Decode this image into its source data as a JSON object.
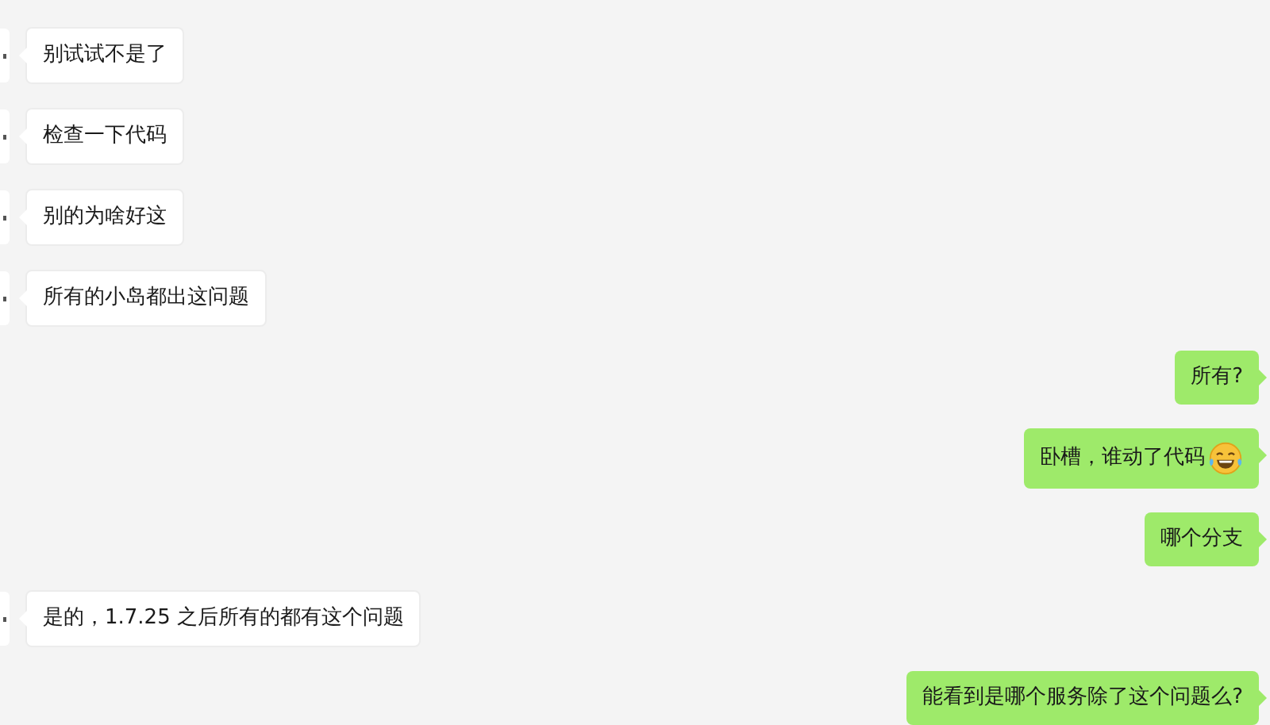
{
  "messages": [
    {
      "kind": "incoming",
      "parts": [
        {
          "kind": "text",
          "text": "别试试不是了"
        }
      ]
    },
    {
      "kind": "incoming",
      "parts": [
        {
          "kind": "text",
          "text": "检查一下代码"
        }
      ]
    },
    {
      "kind": "incoming",
      "parts": [
        {
          "kind": "text",
          "text": "别的为啥好这"
        }
      ]
    },
    {
      "kind": "incoming",
      "parts": [
        {
          "kind": "text",
          "text": "所有的小岛都出这问题"
        }
      ]
    },
    {
      "kind": "outgoing",
      "parts": [
        {
          "kind": "text",
          "text": "所有?"
        }
      ]
    },
    {
      "kind": "outgoing",
      "parts": [
        {
          "kind": "text",
          "text": "卧槽，谁动了代码"
        },
        {
          "kind": "emoji"
        }
      ]
    },
    {
      "kind": "outgoing",
      "parts": [
        {
          "kind": "text",
          "text": "哪个分支"
        }
      ]
    },
    {
      "kind": "incoming",
      "parts": [
        {
          "kind": "text",
          "text": "是的，1.7.25 之后所有的都有这个问题"
        }
      ]
    },
    {
      "kind": "outgoing",
      "parts": [
        {
          "kind": "text",
          "text": "能看到是哪个服务除了这个问题么?"
        }
      ]
    }
  ]
}
